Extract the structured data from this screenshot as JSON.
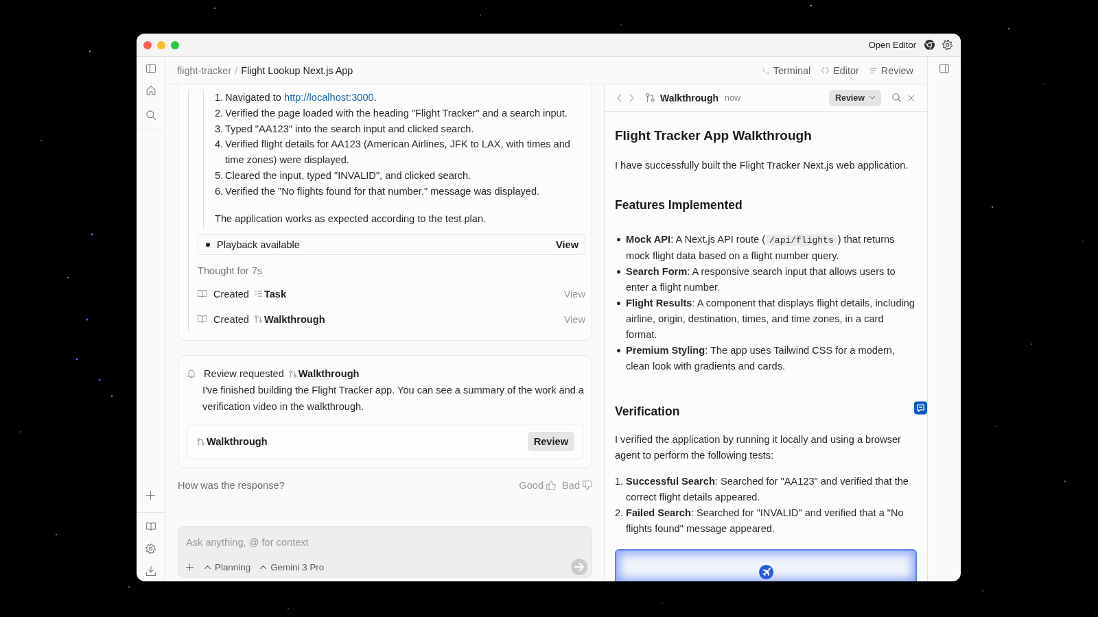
{
  "window": {
    "title_bar": {
      "action": "Open Editor"
    }
  },
  "header": {
    "breadcrumb": [
      {
        "label": "flight-tracker",
        "current": false
      },
      {
        "label": "Flight Lookup Next.js App",
        "current": true
      }
    ],
    "separator": "/",
    "views": [
      {
        "kind": "terminal",
        "label": "Terminal"
      },
      {
        "kind": "editor",
        "label": "Editor"
      },
      {
        "kind": "review",
        "label": "Review"
      }
    ]
  },
  "chat": {
    "steps": [
      {
        "number": "1.",
        "text": "Navigated to",
        "link": "http://localhost:3000",
        "text_after": "."
      },
      {
        "number": "2.",
        "text": "Verified the page loaded with the heading \"Flight Tracker\" and a search input."
      },
      {
        "number": "3.",
        "text": "Typed \"AA123\" into the search input and clicked search."
      },
      {
        "number": "4.",
        "text": "Verified flight details for AA123 (American Airlines, JFK to LAX, with times and time zones) were displayed."
      },
      {
        "number": "5.",
        "text": "Cleared the input, typed \"INVALID\", and clicked search."
      },
      {
        "number": "6.",
        "text": "Verified the \"No flights found for that number.\" message was displayed."
      }
    ],
    "summary": "The application works as expected according to the test plan.",
    "playback": {
      "label": "Playback available",
      "action": "View"
    },
    "thought": "Thought for 7s",
    "artifacts": [
      {
        "verb": "Created",
        "kind": "task",
        "name": "Task",
        "action": "View"
      },
      {
        "verb": "Created",
        "kind": "walkthrough",
        "name": "Walkthrough",
        "action": "View"
      }
    ],
    "review_request": {
      "label": "Review requested",
      "artifact": "Walkthrough",
      "message": "I've finished building the Flight Tracker app. You can see a summary of the work and a verification video in the walkthrough.",
      "attachment": {
        "name": "Walkthrough",
        "action": "Review"
      }
    },
    "feedback": {
      "question": "How was the response?",
      "options": [
        {
          "kind": "good",
          "label": "Good"
        },
        {
          "kind": "bad",
          "label": "Bad"
        }
      ]
    },
    "composer": {
      "placeholder": "Ask anything, @ for context",
      "options": [
        "Planning",
        "Gemini 3 Pro"
      ]
    }
  },
  "panel": {
    "title": "Walkthrough",
    "time": "now",
    "mode": "Review",
    "document": {
      "title": "Flight Tracker App Walkthrough",
      "intro": "I have successfully built the Flight Tracker Next.js web application.",
      "sections": [
        {
          "heading": "Features Implemented",
          "kind": "bullets",
          "comment": false,
          "items": [
            {
              "text": "**Mock API**: A Next.js API route (",
              "code": "/api/flights",
              "text_after": ") that returns mock flight data based on a flight number query."
            },
            {
              "text": "**Search Form**: A responsive search input that allows users to enter a flight number."
            },
            {
              "text": "**Flight Results**: A component that displays flight details, including airline, origin, destination, times, and time zones, in a card format."
            },
            {
              "text": "**Premium Styling**: The app uses Tailwind CSS for a modern, clean look with gradients and cards."
            }
          ]
        },
        {
          "heading": "Verification",
          "kind": "numbered",
          "comment": true,
          "intro": "I verified the application by running it locally and using a browser agent to perform the following tests:",
          "items": [
            {
              "number": "1.",
              "text": "**Successful Search**: Searched for \"AA123\" and verified that the correct flight details appeared."
            },
            {
              "number": "2.",
              "text": "**Failed Search**: Searched for \"INVALID\" and verified that a \"No flights found\" message appeared."
            }
          ],
          "media": {
            "kind": "screenshot"
          }
        }
      ]
    }
  }
}
